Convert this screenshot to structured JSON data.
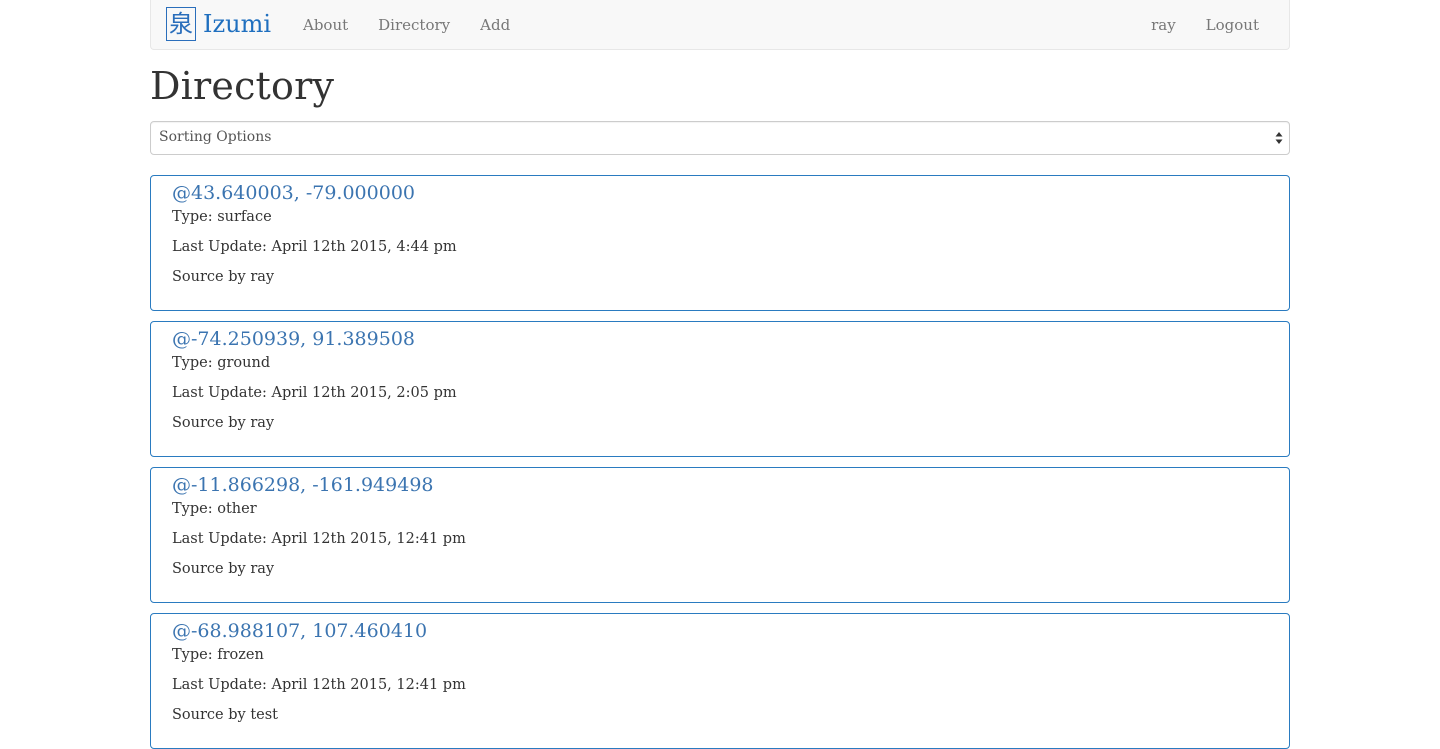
{
  "navbar": {
    "brand_logo": "泉",
    "brand_name": "Izumi",
    "links": [
      "About",
      "Directory",
      "Add"
    ],
    "user": "ray",
    "logout": "Logout"
  },
  "page": {
    "title": "Directory"
  },
  "sort": {
    "selected": "Sorting Options"
  },
  "entries": [
    {
      "title": "@43.640003, -79.000000",
      "type": "Type: surface",
      "last_update": "Last Update: April 12th 2015, 4:44 pm",
      "source": "Source by ray"
    },
    {
      "title": "@-74.250939, 91.389508",
      "type": "Type: ground",
      "last_update": "Last Update: April 12th 2015, 2:05 pm",
      "source": "Source by ray"
    },
    {
      "title": "@-11.866298, -161.949498",
      "type": "Type: other",
      "last_update": "Last Update: April 12th 2015, 12:41 pm",
      "source": "Source by ray"
    },
    {
      "title": "@-68.988107, 107.460410",
      "type": "Type: frozen",
      "last_update": "Last Update: April 12th 2015, 12:41 pm",
      "source": "Source by test"
    }
  ],
  "colors": {
    "accent": "#2a7bc0",
    "brand": "#1f6fbf",
    "navbar_bg": "#f8f8f8"
  }
}
